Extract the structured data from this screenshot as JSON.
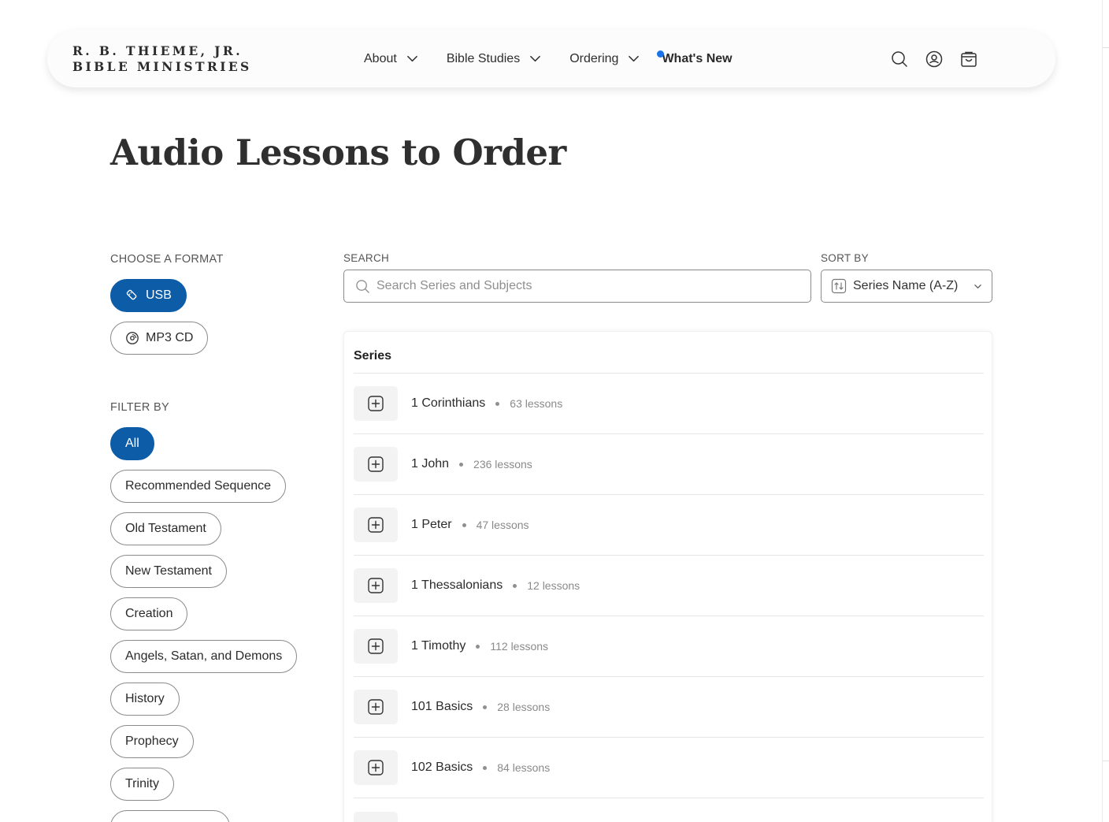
{
  "header": {
    "logo_line1": "R. B. THIEME, JR.",
    "logo_line2": "BIBLE MINISTRIES",
    "nav": [
      {
        "label": "About"
      },
      {
        "label": "Bible Studies"
      },
      {
        "label": "Ordering"
      }
    ],
    "whats_new": "What's New",
    "accent_color": "#1a73e8",
    "icons": [
      "search-icon",
      "account-icon",
      "cart-icon"
    ]
  },
  "page": {
    "title": "Audio Lessons to Order"
  },
  "format": {
    "label": "CHOOSE A FORMAT",
    "options": [
      {
        "label": "USB",
        "icon": "usb-icon",
        "selected": true
      },
      {
        "label": "MP3 CD",
        "icon": "disc-icon",
        "selected": false
      }
    ]
  },
  "filter": {
    "label": "FILTER BY",
    "options": [
      {
        "label": "All",
        "selected": true
      },
      {
        "label": "Recommended Sequence",
        "selected": false
      },
      {
        "label": "Old Testament",
        "selected": false
      },
      {
        "label": "New Testament",
        "selected": false
      },
      {
        "label": "Creation",
        "selected": false
      },
      {
        "label": "Angels, Satan, and Demons",
        "selected": false
      },
      {
        "label": "History",
        "selected": false
      },
      {
        "label": "Prophecy",
        "selected": false
      },
      {
        "label": "Trinity",
        "selected": false
      }
    ],
    "active_color": "#0d5ca8"
  },
  "search": {
    "label": "SEARCH",
    "placeholder": "Search Series and Subjects",
    "value": ""
  },
  "sort": {
    "label": "SORT BY",
    "selected": "Series Name (A-Z)"
  },
  "series": {
    "header": "Series",
    "items": [
      {
        "name": "1 Corinthians",
        "count": "63 lessons"
      },
      {
        "name": "1 John",
        "count": "236 lessons"
      },
      {
        "name": "1 Peter",
        "count": "47 lessons"
      },
      {
        "name": "1 Thessalonians",
        "count": "12 lessons"
      },
      {
        "name": "1 Timothy",
        "count": "112 lessons"
      },
      {
        "name": "101 Basics",
        "count": "28 lessons"
      },
      {
        "name": "102 Basics",
        "count": "84 lessons"
      }
    ]
  }
}
